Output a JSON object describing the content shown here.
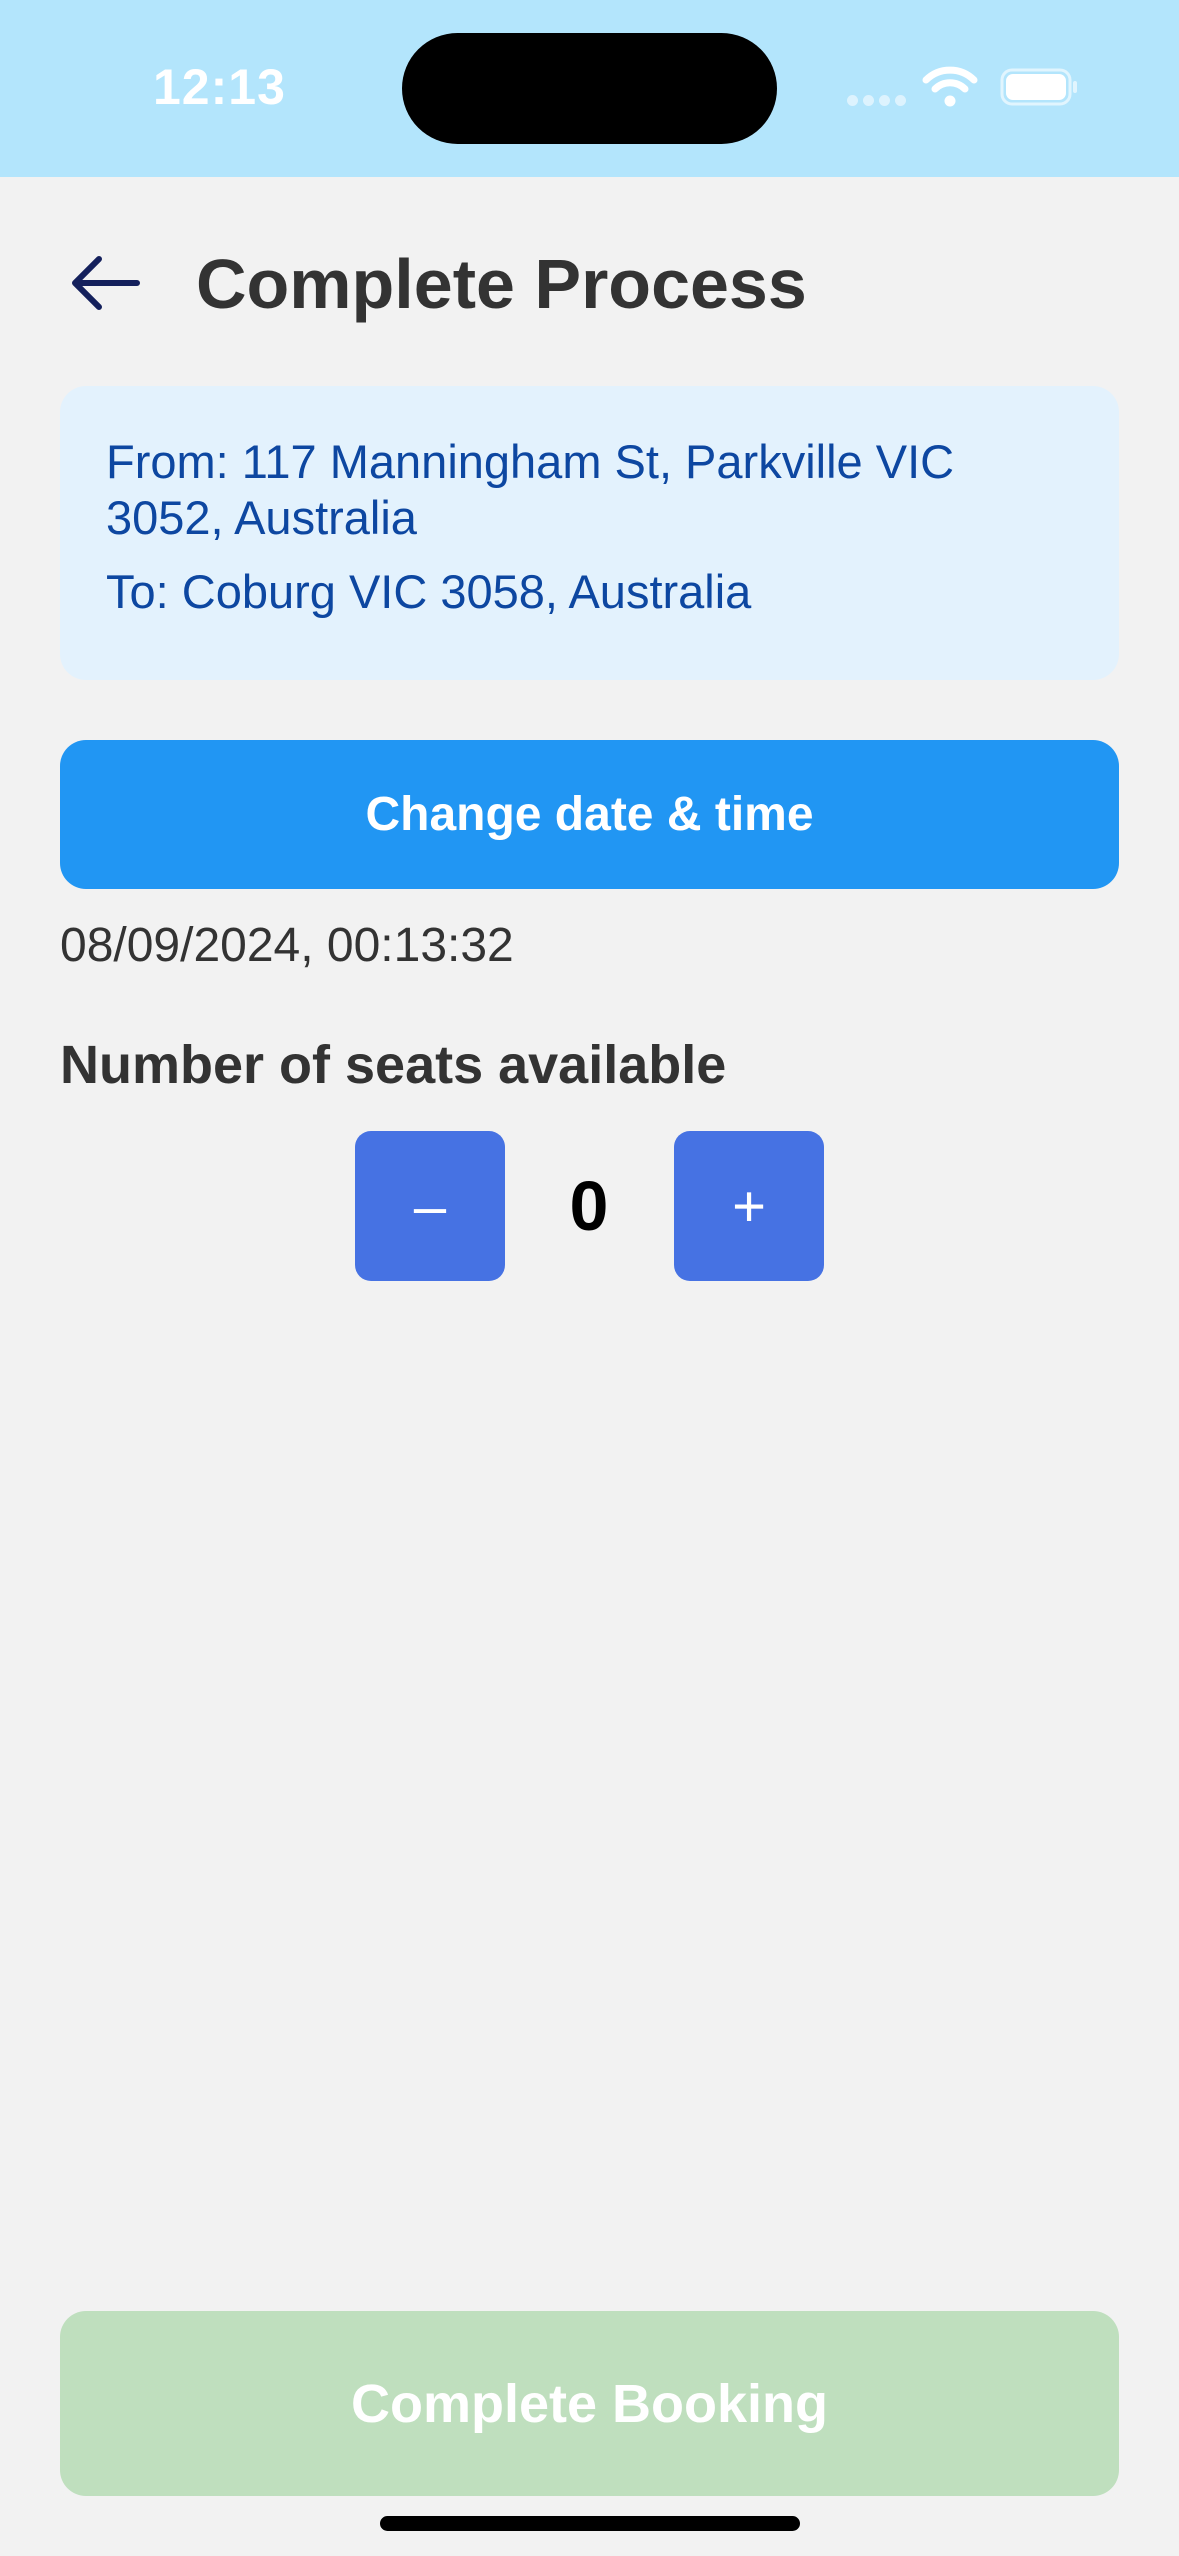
{
  "status_bar": {
    "time": "12:13",
    "icons": [
      "cellular-signal-icon",
      "wifi-icon",
      "battery-icon"
    ]
  },
  "header": {
    "title": "Complete Process",
    "back_icon": "arrow-left-icon"
  },
  "route": {
    "from": "From: 117 Manningham St, Parkville VIC 3052, Australia",
    "to": "To: Coburg VIC 3058, Australia"
  },
  "datetime": {
    "button_label": "Change date & time",
    "value": "08/09/2024, 00:13:32"
  },
  "seats": {
    "label": "Number of seats available",
    "count": "0",
    "decrement_label": "–",
    "increment_label": "+"
  },
  "footer": {
    "complete_label": "Complete Booking"
  },
  "colors": {
    "status_bar_bg": "#b3e5fc",
    "background": "#f2f2f2",
    "route_card_bg": "#e3f2fd",
    "route_text": "#0d47a1",
    "primary_button": "#2196f3",
    "stepper_button": "#4672e3",
    "complete_button_disabled": "#bfdfbe"
  }
}
